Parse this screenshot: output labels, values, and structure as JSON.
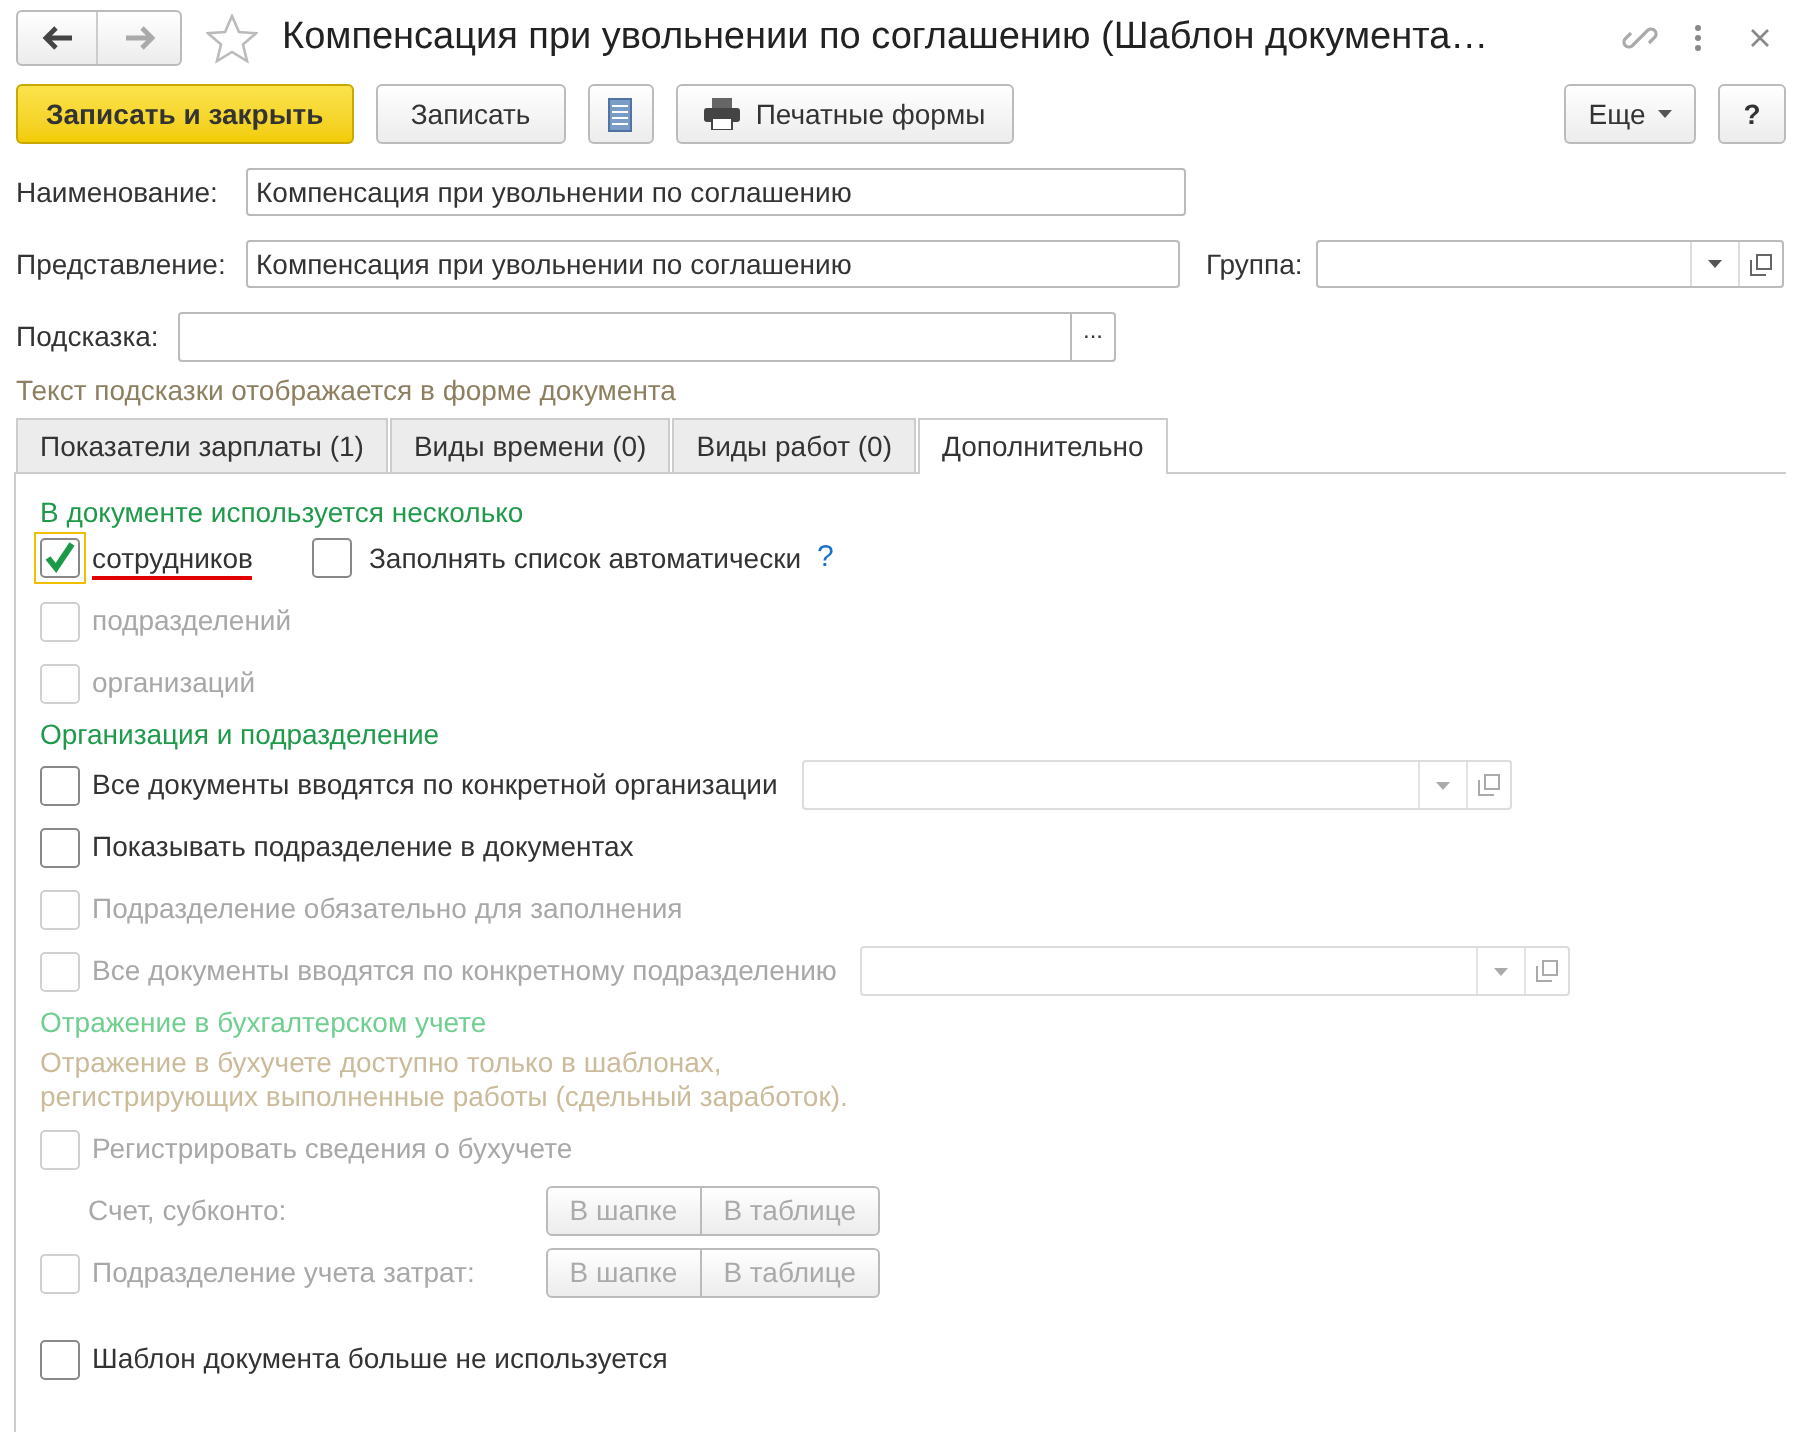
{
  "window": {
    "title": "Компенсация при увольнении по соглашению (Шаблон документа…"
  },
  "toolbar": {
    "save_close": "Записать и закрыть",
    "save": "Записать",
    "print_forms": "Печатные формы",
    "more": "Еще",
    "help": "?"
  },
  "name_field": {
    "label": "Наименование:",
    "value": "Компенсация при увольнении по соглашению"
  },
  "presentation_field": {
    "label": "Представление:",
    "value": "Компенсация при увольнении по соглашению"
  },
  "group_field": {
    "label": "Группа:"
  },
  "hint_field": {
    "label": "Подсказка:",
    "button": "..."
  },
  "hint_note": "Текст подсказки отображается в форме документа",
  "tabs": [
    {
      "label": "Показатели зарплаты (1)",
      "selected": false
    },
    {
      "label": "Виды времени (0)",
      "selected": false
    },
    {
      "label": "Виды работ (0)",
      "selected": false
    },
    {
      "label": "Дополнительно",
      "selected": true
    }
  ],
  "rows": [
    {
      "kind": "heading",
      "text": "В документе используется несколько",
      "disabled": false
    },
    {
      "kind": "checkbox",
      "label": "сотрудников",
      "checked": true,
      "disabled": false,
      "focused": true,
      "underlined": true,
      "extra": {
        "label": "Заполнять список автоматически",
        "checked": false,
        "help": "?"
      }
    },
    {
      "kind": "checkbox",
      "label": "подразделений",
      "checked": false,
      "disabled": true
    },
    {
      "kind": "checkbox",
      "label": "организаций",
      "checked": false,
      "disabled": true
    },
    {
      "kind": "heading",
      "text": "Организация и подразделение",
      "disabled": false
    },
    {
      "kind": "checkbox",
      "label": "Все документы вводятся по конкретной организации",
      "checked": false,
      "disabled": false,
      "select": true
    },
    {
      "kind": "checkbox",
      "label": "Показывать подразделение в документах",
      "checked": false,
      "disabled": false
    },
    {
      "kind": "checkbox",
      "label": "Подразделение обязательно для заполнения",
      "checked": false,
      "disabled": true
    },
    {
      "kind": "checkbox",
      "label": "Все документы вводятся по конкретному подразделению",
      "checked": false,
      "disabled": true,
      "select": true
    },
    {
      "kind": "heading",
      "text": "Отражение в бухгалтерском учете",
      "disabled": true
    },
    {
      "kind": "note",
      "text": "Отражение в бухучете доступно только в шаблонах,\nрегистрирующих выполненные работы (сдельный заработок)."
    },
    {
      "kind": "checkbox",
      "label": "Регистрировать сведения о бухучете",
      "checked": false,
      "disabled": true
    },
    {
      "kind": "label",
      "label": "Счет, субконто:",
      "disabled": true,
      "buttons": [
        "В шапке",
        "В таблице"
      ]
    },
    {
      "kind": "checkbox",
      "label": "Подразделение учета затрат:",
      "checked": false,
      "disabled": true,
      "buttons": [
        "В шапке",
        "В таблице"
      ]
    },
    {
      "kind": "checkbox",
      "label": "Шаблон документа больше не используется",
      "checked": false,
      "disabled": false,
      "spaced": true
    }
  ]
}
